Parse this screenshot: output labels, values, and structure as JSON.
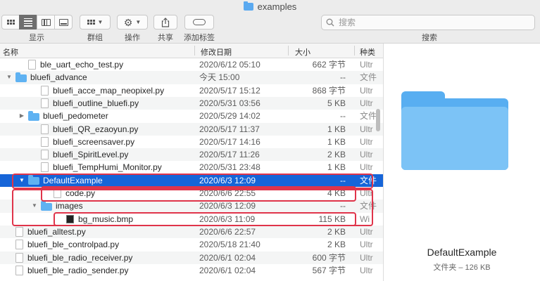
{
  "window": {
    "title": "examples",
    "icon": "folder-icon"
  },
  "toolbar": {
    "view_label": "显示",
    "group_label": "群组",
    "action_label": "操作",
    "share_label": "共享",
    "tag_label": "添加标签",
    "search_label": "搜索",
    "search_placeholder": "搜索"
  },
  "columns": {
    "name": "名称",
    "date": "修改日期",
    "size": "大小",
    "kind": "种类"
  },
  "rows": [
    {
      "name": "ble_uart_echo_test.py",
      "date": "2020/6/12 05:10",
      "size": "662 字节",
      "kind": "Ultr",
      "type": "file",
      "indent": 1
    },
    {
      "name": "bluefi_advance",
      "date": "今天 15:00",
      "size": "--",
      "kind": "文件",
      "type": "folder",
      "indent": 0,
      "expanded": true
    },
    {
      "name": "bluefi_acce_map_neopixel.py",
      "date": "2020/5/17 15:12",
      "size": "868 字节",
      "kind": "Ultr",
      "type": "file",
      "indent": 2
    },
    {
      "name": "bluefi_outline_bluefi.py",
      "date": "2020/5/31 03:56",
      "size": "5 KB",
      "kind": "Ultr",
      "type": "file",
      "indent": 2
    },
    {
      "name": "bluefi_pedometer",
      "date": "2020/5/29 14:02",
      "size": "--",
      "kind": "文件",
      "type": "folder",
      "indent": 1,
      "expanded": false
    },
    {
      "name": "bluefi_QR_ezaoyun.py",
      "date": "2020/5/17 11:37",
      "size": "1 KB",
      "kind": "Ultr",
      "type": "file",
      "indent": 2
    },
    {
      "name": "bluefi_screensaver.py",
      "date": "2020/5/17 14:16",
      "size": "1 KB",
      "kind": "Ultr",
      "type": "file",
      "indent": 2
    },
    {
      "name": "bluefi_SpiritLevel.py",
      "date": "2020/5/17 11:26",
      "size": "2 KB",
      "kind": "Ultr",
      "type": "file",
      "indent": 2
    },
    {
      "name": "bluefi_TempHumi_Monitor.py",
      "date": "2020/5/31 23:48",
      "size": "1 KB",
      "kind": "Ultr",
      "type": "file",
      "indent": 2
    },
    {
      "name": "DefaultExample",
      "date": "2020/6/3 12:09",
      "size": "--",
      "kind": "文件",
      "type": "folder",
      "indent": 1,
      "expanded": true,
      "selected": true
    },
    {
      "name": "code.py",
      "date": "2020/6/6 22:55",
      "size": "4 KB",
      "kind": "Ultr",
      "type": "file",
      "indent": 3
    },
    {
      "name": "images",
      "date": "2020/6/3 12:09",
      "size": "--",
      "kind": "文件",
      "type": "folder",
      "indent": 2,
      "expanded": true
    },
    {
      "name": "bg_music.bmp",
      "date": "2020/6/3 11:09",
      "size": "115 KB",
      "kind": "Wi",
      "type": "bmp",
      "indent": 4
    },
    {
      "name": "bluefi_alltest.py",
      "date": "2020/6/6 22:57",
      "size": "2 KB",
      "kind": "Ultr",
      "type": "file",
      "indent": 0
    },
    {
      "name": "bluefi_ble_controlpad.py",
      "date": "2020/5/18 21:40",
      "size": "2 KB",
      "kind": "Ultr",
      "type": "file",
      "indent": 0
    },
    {
      "name": "bluefi_ble_radio_receiver.py",
      "date": "2020/6/1 02:04",
      "size": "600 字节",
      "kind": "Ultr",
      "type": "file",
      "indent": 0
    },
    {
      "name": "bluefi_ble_radio_sender.py",
      "date": "2020/6/1 02:04",
      "size": "567 字节",
      "kind": "Ultr",
      "type": "file",
      "indent": 0
    }
  ],
  "highlight_color": "#e0344a",
  "selection_color": "#1665d8",
  "preview": {
    "name": "DefaultExample",
    "info": "文件夹 – 126 KB",
    "icon": "large-folder-icon"
  }
}
